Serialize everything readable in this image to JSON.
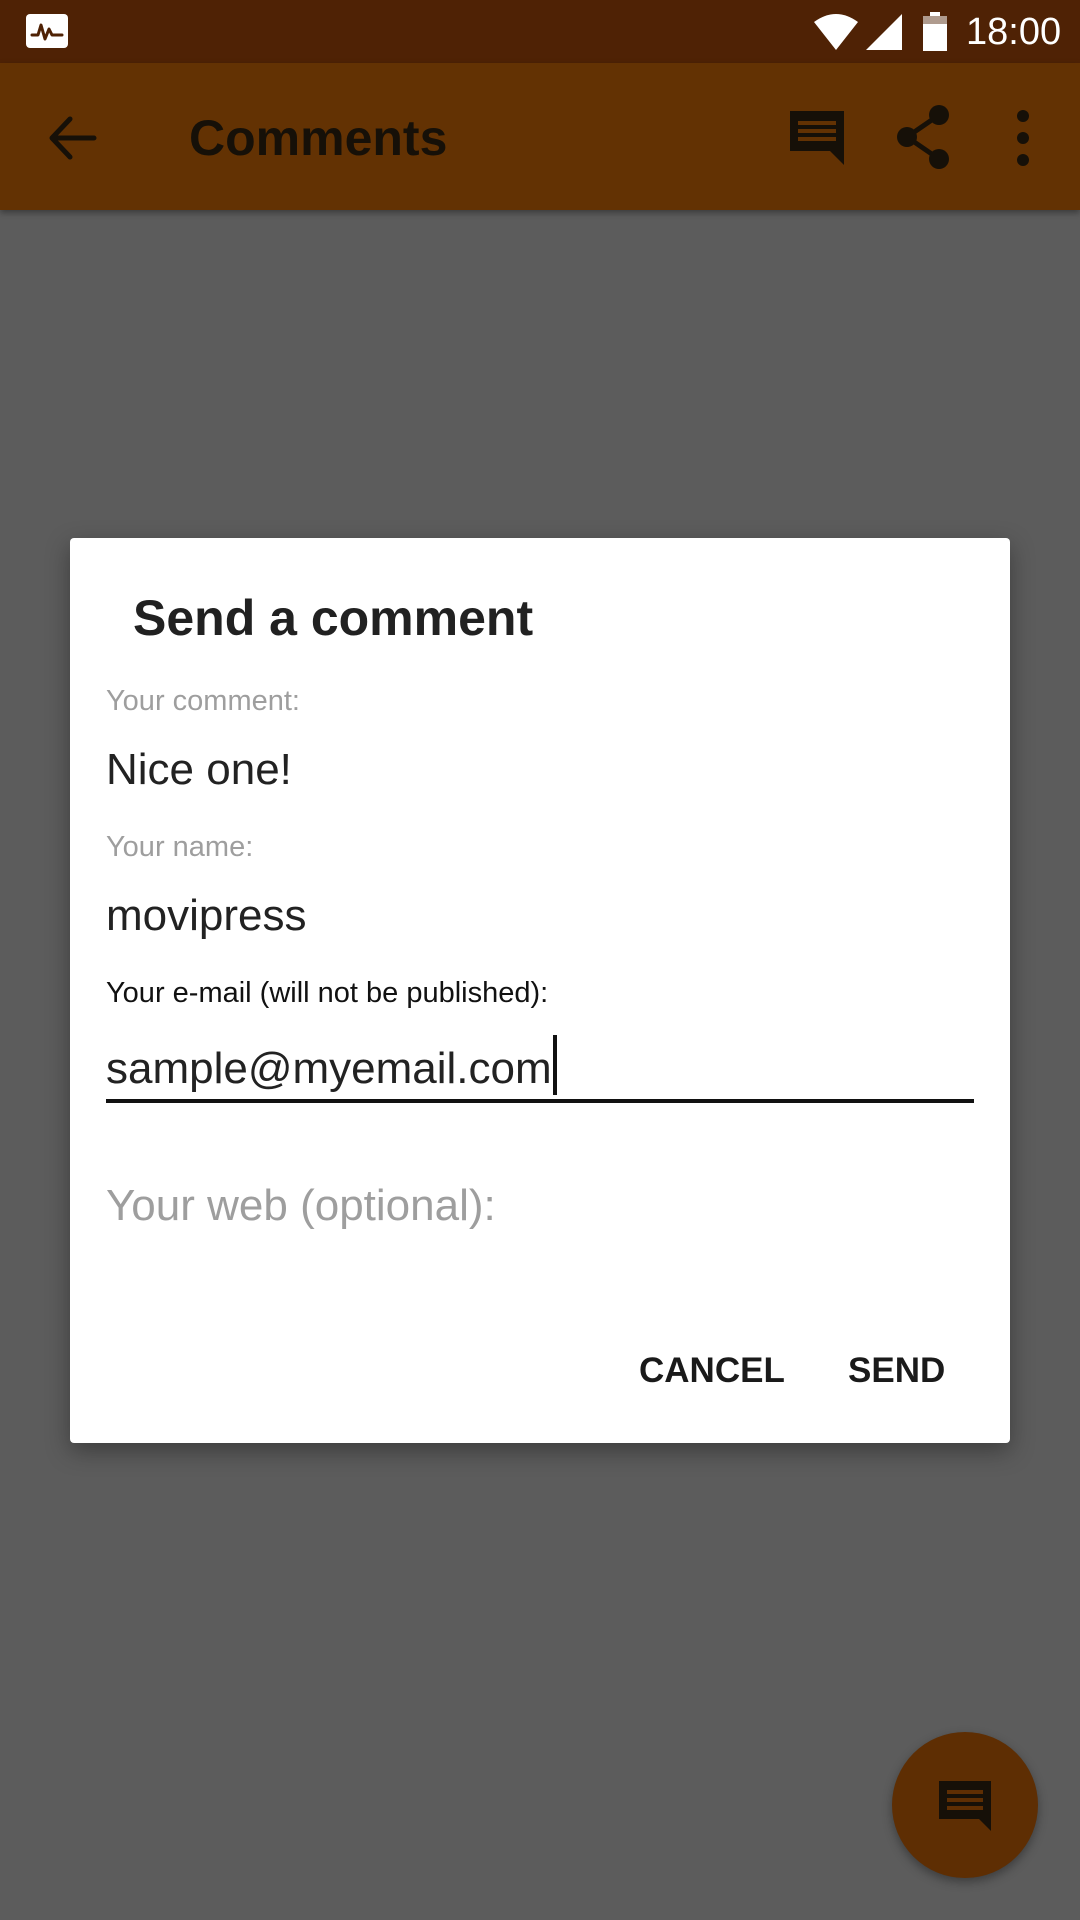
{
  "status_bar": {
    "time": "18:00",
    "icons": [
      "activity-app-icon",
      "wifi-icon",
      "signal-icon",
      "battery-icon"
    ]
  },
  "app_bar": {
    "title": "Comments",
    "actions": [
      "back-arrow-icon",
      "comment-icon",
      "share-icon",
      "more-vert-icon"
    ]
  },
  "dialog": {
    "title": "Send a comment",
    "comment_field": {
      "label": "Your comment:",
      "value": "Nice one!"
    },
    "name_field": {
      "label": "Your name:",
      "value": "movipress"
    },
    "email_field": {
      "label": "Your e-mail (will not be published):",
      "value": "sample@myemail.com"
    },
    "web_field": {
      "placeholder": "Your web (optional):",
      "value": ""
    },
    "cancel_label": "CANCEL",
    "send_label": "SEND"
  },
  "fab": {
    "icon": "comment-icon"
  },
  "colors": {
    "status_bar": "#4f2205",
    "app_bar": "#633203",
    "scrim_background": "#5c5c5c",
    "fab": "#5e2e03",
    "dialog": "#ffffff"
  }
}
